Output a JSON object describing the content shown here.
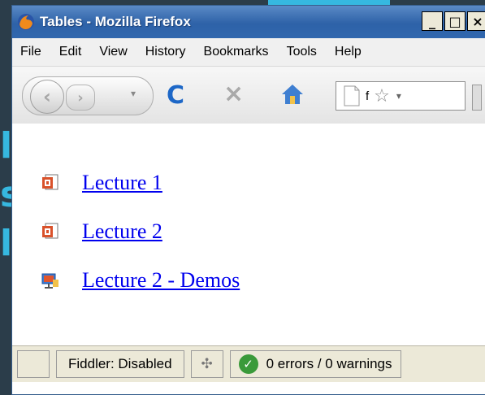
{
  "background": {
    "glyphs": [
      "l",
      "s",
      "l"
    ]
  },
  "window": {
    "title": "Tables - Mozilla Firefox",
    "controls": {
      "minimize": "_",
      "maximize": "□",
      "close": "×"
    }
  },
  "menubar": {
    "items": [
      "File",
      "Edit",
      "View",
      "History",
      "Bookmarks",
      "Tools",
      "Help"
    ]
  },
  "toolbar": {
    "back": "‹",
    "forward": "›",
    "dropdown": "▾",
    "reload": "C",
    "stop": "×",
    "url_text": "f",
    "star": "☆",
    "url_dropdown": "▾"
  },
  "content": {
    "links": [
      {
        "label": "Lecture 1",
        "icon": "powerpoint-icon"
      },
      {
        "label": "Lecture 2",
        "icon": "powerpoint-icon"
      },
      {
        "label": "Lecture 2 - Demos",
        "icon": "folder-presentation-icon"
      }
    ]
  },
  "statusbar": {
    "fiddler": "Fiddler: Disabled",
    "spider": "✣",
    "checkmark": "✓",
    "errors": "0 errors / 0 warnings"
  }
}
